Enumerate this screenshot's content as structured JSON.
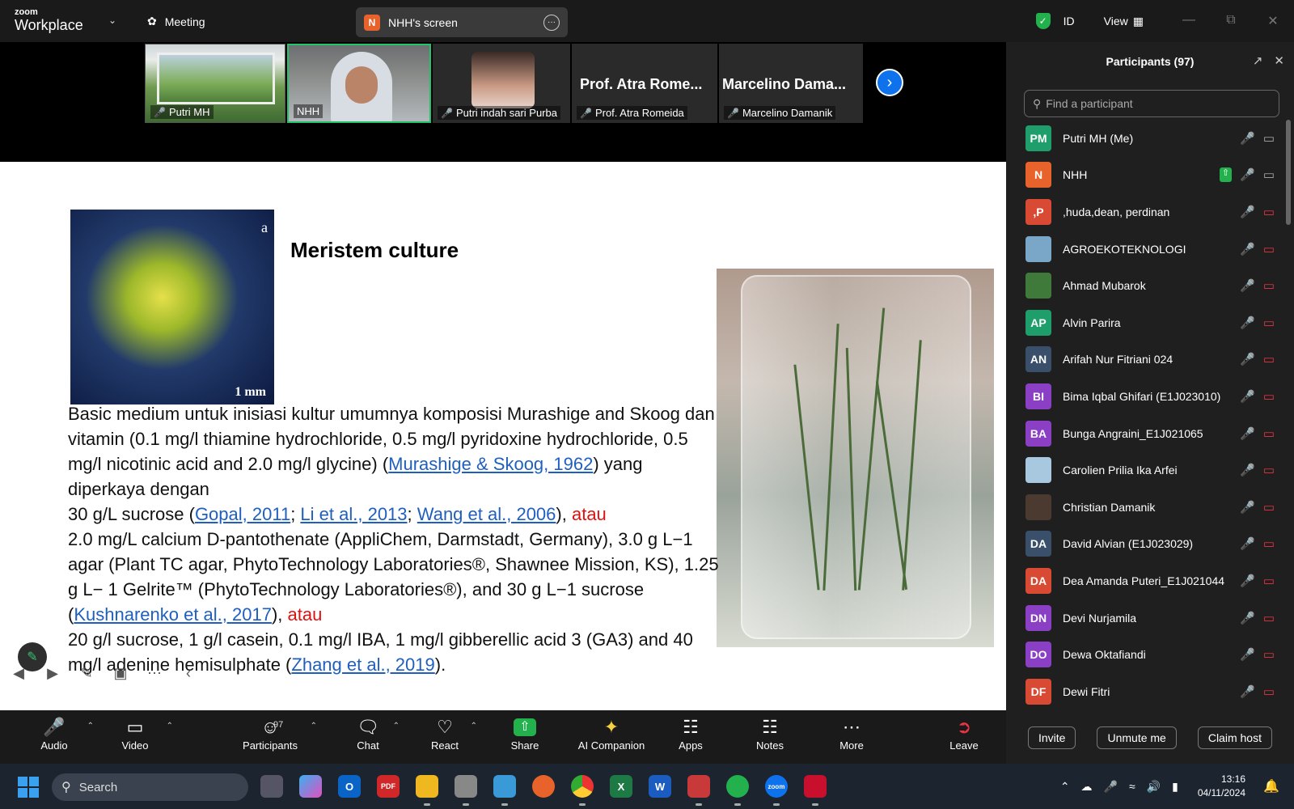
{
  "app": {
    "brand_top": "zoom",
    "brand_bottom": "Workplace",
    "meeting_label": "Meeting"
  },
  "screen_share": {
    "initial": "N",
    "label": "NHH's screen"
  },
  "topright": {
    "id_label": "ID",
    "view_label": "View"
  },
  "video_tiles": [
    {
      "name": "Putri MH"
    },
    {
      "name": "NHH"
    },
    {
      "name": "Putri indah sari Purba"
    },
    {
      "big": "Prof. Atra Rome...",
      "name": "Prof. Atra Romeida"
    },
    {
      "big": "Marcelino Dama...",
      "name": "Marcelino Damanik"
    }
  ],
  "slide": {
    "title": "Meristem culture",
    "image_a_letter": "a",
    "image_a_scale": "1 mm",
    "p1": "Basic medium untuk inisiasi kultur umumnya komposisi Murashige and Skoog dan vitamin (0.1 mg/l thiamine hydrochloride, 0.5 mg/l pyridoxine hydrochloride, 0.5 mg/l nicotinic acid and 2.0 mg/l glycine) (",
    "p1_link": "Murashige & Skoog, 1962",
    "p1_end": ") yang diperkaya dengan",
    "l2_pre": "30 g/L sucrose (",
    "l2_link1": "Gopal, 2011",
    "l2_sep1": "; ",
    "l2_link2": "Li et al., 2013",
    "l2_sep2": "; ",
    "l2_link3": "Wang et al., 2006",
    "l2_end": "), ",
    "atau": "atau",
    "l3": "2.0 mg/L calcium D-pantothenate (AppliChem, Darmstadt, Germany), 3.0 g L−1 agar (Plant TC agar, PhytoTechnology Laboratories®, Shawnee Mission, KS), 1.25 g L− 1 Gelrite™ (PhytoTechnology Laboratories®), and 30 g L−1 sucrose (",
    "l3_link": "Kushnarenko et al., 2017",
    "l3_end": "), ",
    "l4": "20 g/l sucrose, 1 g/l casein, 0.1 mg/l IBA, 1 mg/l gibberellic acid 3 (GA3) and 40 mg/l adenine hemisulphate (",
    "l4_link": "Zhang et al., 2019",
    "l4_end": ")."
  },
  "toolbar": {
    "audio": "Audio",
    "video": "Video",
    "participants": "Participants",
    "participants_count": "97",
    "chat": "Chat",
    "react": "React",
    "share": "Share",
    "ai": "AI Companion",
    "apps": "Apps",
    "notes": "Notes",
    "more": "More",
    "leave": "Leave"
  },
  "panel": {
    "title": "Participants (97)",
    "search_placeholder": "Find a participant",
    "participants": [
      {
        "initials": "PM",
        "name": "Putri MH (Me)",
        "color": "#1e9e6a"
      },
      {
        "initials": "N",
        "name": "NHH",
        "color": "#e8632b"
      },
      {
        "initials": ",P",
        "name": ",huda,dean, perdinan",
        "color": "#d94a35"
      },
      {
        "initials": "",
        "name": "AGROEKOTEKNOLOGI",
        "color": "#7aa6c8"
      },
      {
        "initials": "",
        "name": "Ahmad Mubarok",
        "color": "#3f7a3a"
      },
      {
        "initials": "AP",
        "name": "Alvin Parira",
        "color": "#1e9e6a"
      },
      {
        "initials": "AN",
        "name": "Arifah Nur Fitriani 024",
        "color": "#3a4f6a"
      },
      {
        "initials": "BI",
        "name": "Bima Iqbal Ghifari (E1J023010)",
        "color": "#8a3fc4"
      },
      {
        "initials": "BA",
        "name": "Bunga Angraini_E1J021065",
        "color": "#8a3fc4"
      },
      {
        "initials": "",
        "name": "Carolien Prilia Ika Arfei",
        "color": "#a8c8e0"
      },
      {
        "initials": "",
        "name": "Christian Damanik",
        "color": "#4a3a30"
      },
      {
        "initials": "DA",
        "name": "David Alvian (E1J023029)",
        "color": "#3a4f6a"
      },
      {
        "initials": "DA",
        "name": "Dea Amanda Puteri_E1J021044",
        "color": "#d94a35"
      },
      {
        "initials": "DN",
        "name": "Devi Nurjamila",
        "color": "#8a3fc4"
      },
      {
        "initials": "DO",
        "name": "Dewa Oktafiandi",
        "color": "#8a3fc4"
      },
      {
        "initials": "DF",
        "name": "Dewi Fitri",
        "color": "#d94a35"
      }
    ],
    "invite": "Invite",
    "unmute": "Unmute me",
    "claim": "Claim host"
  },
  "taskbar": {
    "search": "Search",
    "time": "13:16",
    "date": "04/11/2024"
  }
}
